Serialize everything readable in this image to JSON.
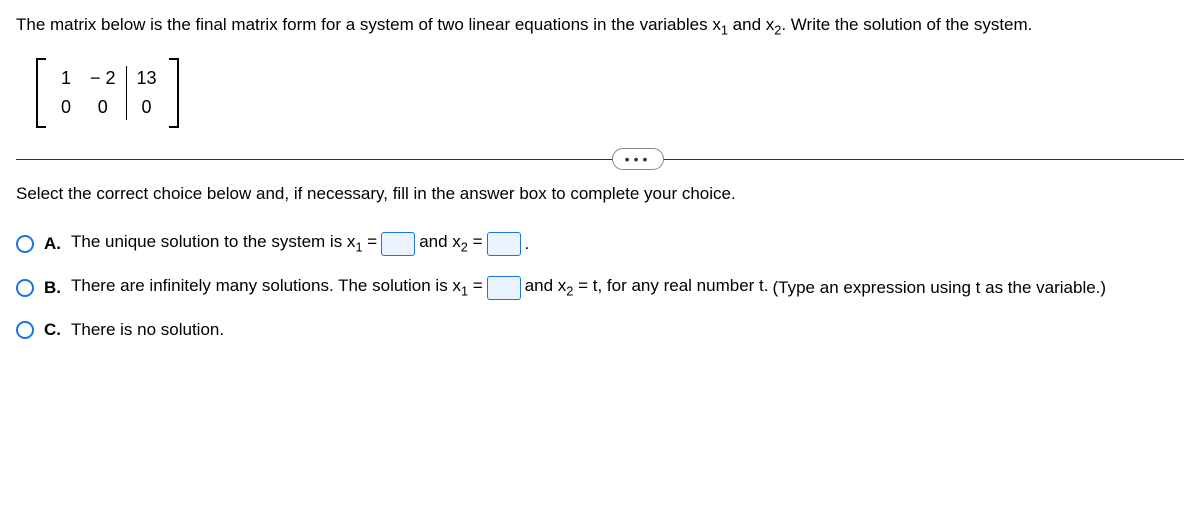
{
  "problem": {
    "text_before": "The matrix below is the final matrix form for a system of two linear equations in the variables x",
    "sub1": "1",
    "mid": " and x",
    "sub2": "2",
    "text_after": ". Write the solution of the system."
  },
  "matrix": {
    "r1c1": "1",
    "r1c2": "− 2",
    "r1c3": "13",
    "r2c1": "0",
    "r2c2": "0",
    "r2c3": "0"
  },
  "ellipsis": "•••",
  "select_text": "Select the correct choice below and, if necessary, fill in the answer box to complete your choice.",
  "options": {
    "a": {
      "label": "A.",
      "t1": "The unique solution to the system is x",
      "s1": "1",
      "t2": " = ",
      "t3": " and x",
      "s2": "2",
      "t4": " = ",
      "t5": "."
    },
    "b": {
      "label": "B.",
      "t1": "There are infinitely many solutions. The solution is x",
      "s1": "1",
      "t2": " = ",
      "t3": " and x",
      "s2": "2",
      "t4": " = t, for any real number t. ",
      "hint": "(Type an expression using t as the variable.)"
    },
    "c": {
      "label": "C.",
      "t1": "There is no solution."
    }
  }
}
